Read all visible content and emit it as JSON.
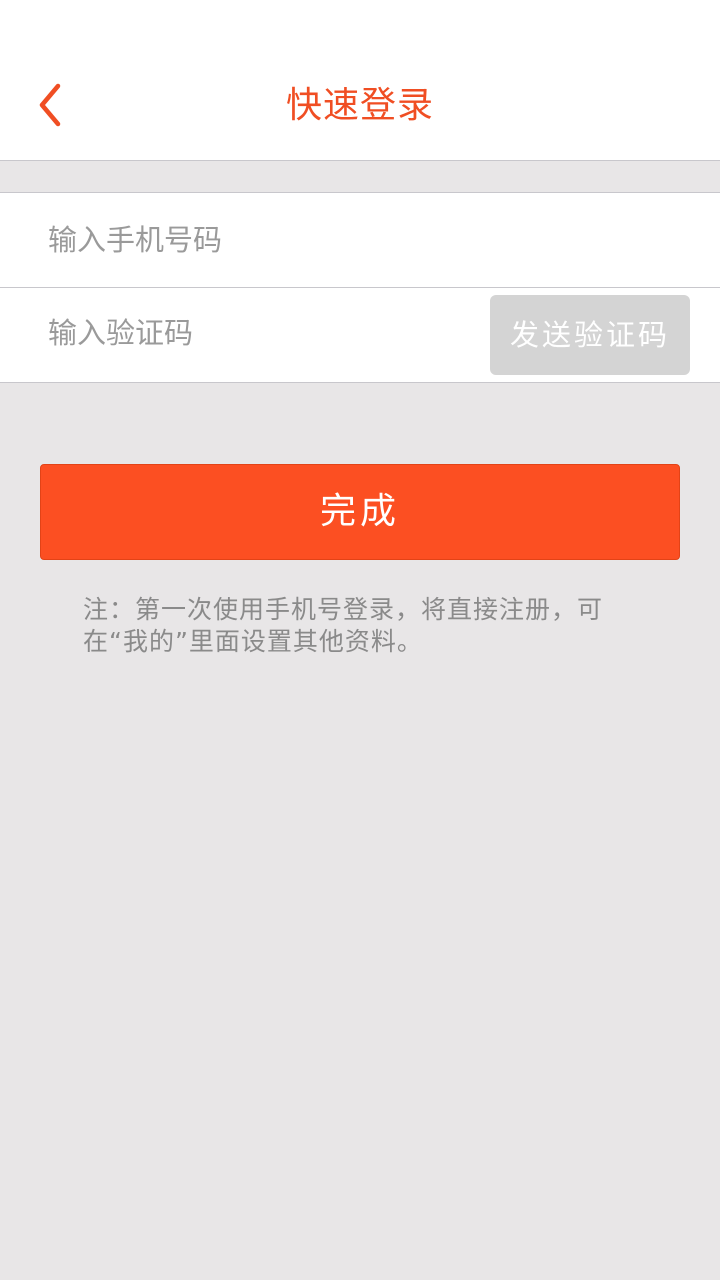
{
  "header": {
    "title": "快速登录",
    "back_icon": "chevron-left-icon",
    "accent_color": "#f04e23"
  },
  "form": {
    "phone_placeholder": "输入手机号码",
    "phone_value": "",
    "code_placeholder": "输入验证码",
    "code_value": "",
    "send_code_label": "发送验证码"
  },
  "done_button": {
    "label": "完成",
    "color": "#fc4f22"
  },
  "note": {
    "text": "注：第一次使用手机号登录，将直接注册，可在“我的”里面设置其他资料。"
  }
}
